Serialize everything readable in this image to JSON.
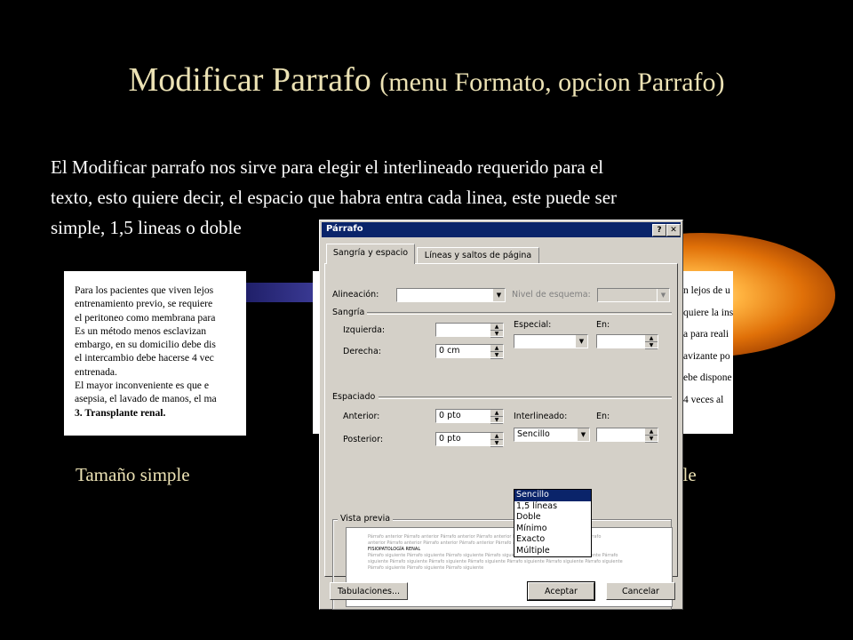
{
  "slide": {
    "title_main": "Modificar Parrafo",
    "title_sub": "(menu Formato, opcion Parrafo)",
    "body_lines": [
      "El Modificar parrafo nos sirve para elegir el interlineado requerido para el",
      "texto, esto quiere decir, el espacio que habra entra cada linea, este puede ser",
      "simple, 1,5 lineas o doble"
    ],
    "caption_simple": "Tamaño simple",
    "caption_double": "ble"
  },
  "doc_left": {
    "lines": [
      "Para los pacientes que viven lejos",
      "entrenamiento previo, se requiere",
      "el peritoneo como membrana para",
      "Es un método menos esclavizan",
      "embargo, en su domicilio debe dis",
      "el intercambio debe hacerse 4 vec",
      "entrenada.",
      "El mayor inconveniente es que e",
      "asepsia, el lavado de manos, el ma",
      "3.   Transplante renal."
    ]
  },
  "doc_right": {
    "lines": [
      "n lejos de u",
      "quiere la ins",
      "a para reali",
      "avizante po",
      "ebe dispone",
      "4 veces al"
    ]
  },
  "dialog": {
    "title": "Párrafo",
    "help_label": "?",
    "close_label": "✕",
    "tabs": [
      "Sangría y espacio",
      "Líneas y saltos de página"
    ],
    "alignment_label": "Alineación:",
    "alignment_value": "",
    "outline_label": "Nivel de esquema:",
    "outline_value": "",
    "indent_group": "Sangría",
    "left_label": "Izquierda:",
    "left_value": "",
    "right_label": "Derecha:",
    "right_value": "0 cm",
    "special_label": "Especial:",
    "special_value": "",
    "by_label": "En:",
    "by_value": "",
    "spacing_group": "Espaciado",
    "before_label": "Anterior:",
    "before_value": "0 pto",
    "after_label": "Posterior:",
    "after_value": "0 pto",
    "line_spacing_label": "Interlineado:",
    "line_spacing_value": "Sencillo",
    "at_label": "En:",
    "at_value": "",
    "line_spacing_options": [
      "Sencillo",
      "1,5 líneas",
      "Doble",
      "Mínimo",
      "Exacto",
      "Múltiple"
    ],
    "preview_group": "Vista previa",
    "preview_lines": [
      "Párrafo anterior Párrafo anterior Párrafo anterior Párrafo anterior Párrafo anterior Párrafo anterior Párrafo",
      "anterior Párrafo anterior Párrafo anterior Párrafo anterior Párrafo anterior",
      "FISIOPATOLOGÍA RENAL",
      "Párrafo siguiente Párrafo siguiente Párrafo siguiente Párrafo siguiente Párrafo siguiente Párrafo siguiente Párrafo",
      "siguiente Párrafo siguiente Párrafo siguiente Párrafo siguiente Párrafo siguiente Párrafo siguiente Párrafo siguiente",
      "Párrafo siguiente Párrafo siguiente Párrafo siguiente"
    ],
    "tabs_button": "Tabulaciones...",
    "accept_button": "Aceptar",
    "cancel_button": "Cancelar"
  }
}
